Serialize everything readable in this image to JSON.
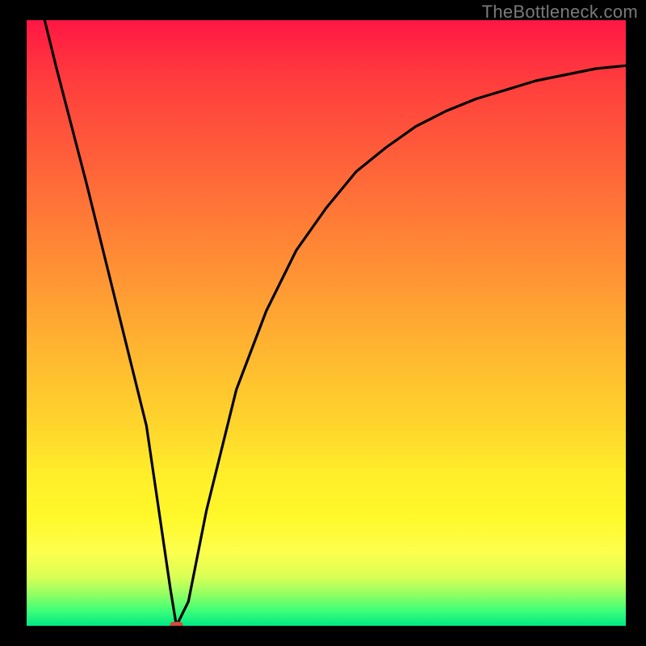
{
  "watermark": "TheBottleneck.com",
  "chart_data": {
    "type": "line",
    "title": "",
    "xlabel": "",
    "ylabel": "",
    "xlim": [
      0,
      100
    ],
    "ylim": [
      0,
      100
    ],
    "grid": false,
    "legend": false,
    "series": [
      {
        "name": "bottleneck-curve",
        "x": [
          3,
          5,
          10,
          15,
          20,
          24,
          25,
          27,
          30,
          35,
          40,
          45,
          50,
          55,
          60,
          65,
          70,
          75,
          80,
          85,
          90,
          95,
          100
        ],
        "y": [
          100,
          92,
          73,
          53,
          33,
          6,
          0,
          4,
          19,
          39,
          52,
          62,
          69,
          75,
          79,
          82.5,
          85,
          87,
          88.5,
          90,
          91,
          92,
          92.5
        ]
      }
    ],
    "marker": {
      "x": 25,
      "y": 0,
      "shape": "rounded-rect"
    },
    "background_gradient": {
      "direction": "top-to-bottom",
      "stops": [
        {
          "pos": 0,
          "color": "#ff1744"
        },
        {
          "pos": 0.5,
          "color": "#ffb030"
        },
        {
          "pos": 0.8,
          "color": "#fff12a"
        },
        {
          "pos": 1.0,
          "color": "#00e884"
        }
      ]
    }
  }
}
